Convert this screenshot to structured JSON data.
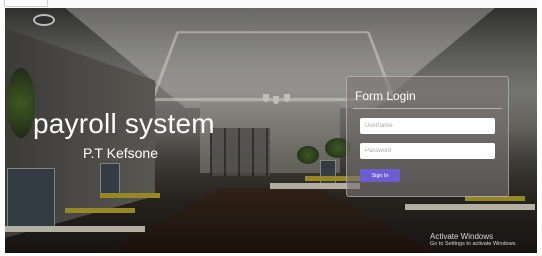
{
  "hero": {
    "title": "payroll system",
    "subtitle": "P.T Kefsone"
  },
  "login": {
    "title": "Form Login",
    "username_placeholder": "Username",
    "password_placeholder": "Password",
    "signin_label": "Sign In"
  },
  "watermark": {
    "title": "Activate Windows",
    "subtitle": "Go to Settings to activate Windows."
  },
  "colors": {
    "signin_button": "#6c5ed2",
    "panel": "#787373",
    "text": "#ffffff"
  }
}
